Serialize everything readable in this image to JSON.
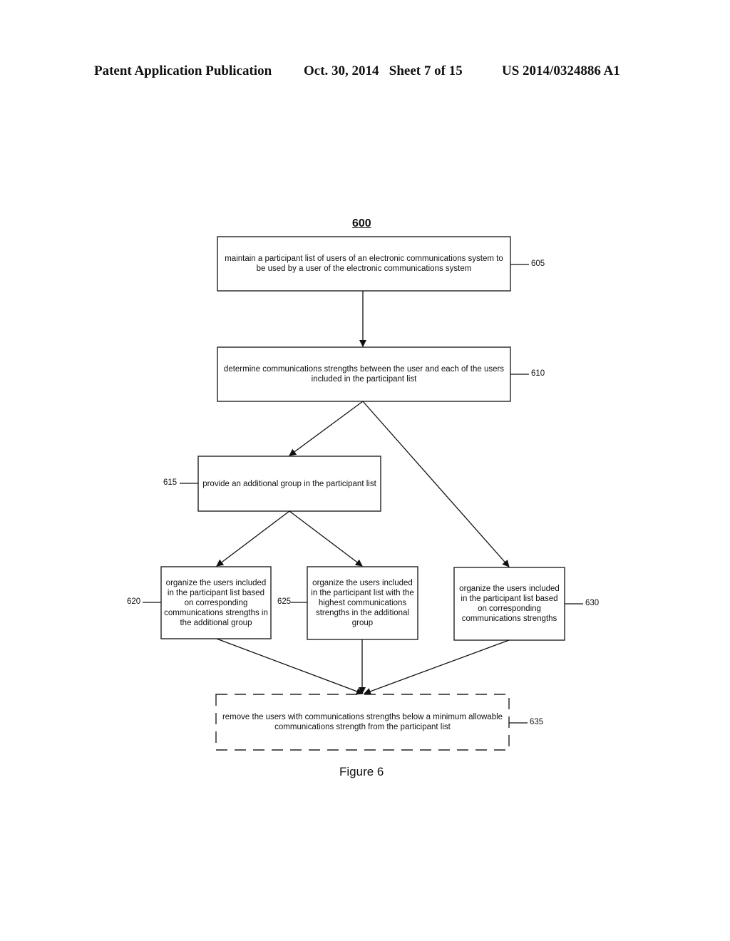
{
  "header": {
    "publication": "Patent Application Publication",
    "date_sheet": "Oct. 30, 2014   Sheet 7 of 15",
    "number": "US 2014/0324886 A1"
  },
  "diagram": {
    "title": "600",
    "figure_label": "Figure 6",
    "boxes": [
      {
        "ref": "605",
        "text": "maintain a participant list of users of an electronic communications system to be used by a user of the electronic communications system"
      },
      {
        "ref": "610",
        "text": "determine communications strengths between the user and each of the users included in the participant list"
      },
      {
        "ref": "615",
        "text": "provide an additional group in the participant list"
      },
      {
        "ref": "620",
        "text": "organize the users included in the participant list based on corresponding communications strengths in the additional group"
      },
      {
        "ref": "625",
        "text": "organize the users included in the participant list with the highest communications strengths in the additional group"
      },
      {
        "ref": "630",
        "text": "organize the users included in the participant list based on corresponding communications strengths"
      },
      {
        "ref": "635",
        "text": "remove the users with communications strengths below a minimum allowable communications strength from the participant list",
        "style": "dashed"
      }
    ],
    "edges": [
      [
        "605",
        "610"
      ],
      [
        "610",
        "615"
      ],
      [
        "610",
        "630"
      ],
      [
        "615",
        "620"
      ],
      [
        "615",
        "625"
      ],
      [
        "620",
        "635"
      ],
      [
        "625",
        "635"
      ],
      [
        "630",
        "635"
      ]
    ]
  }
}
